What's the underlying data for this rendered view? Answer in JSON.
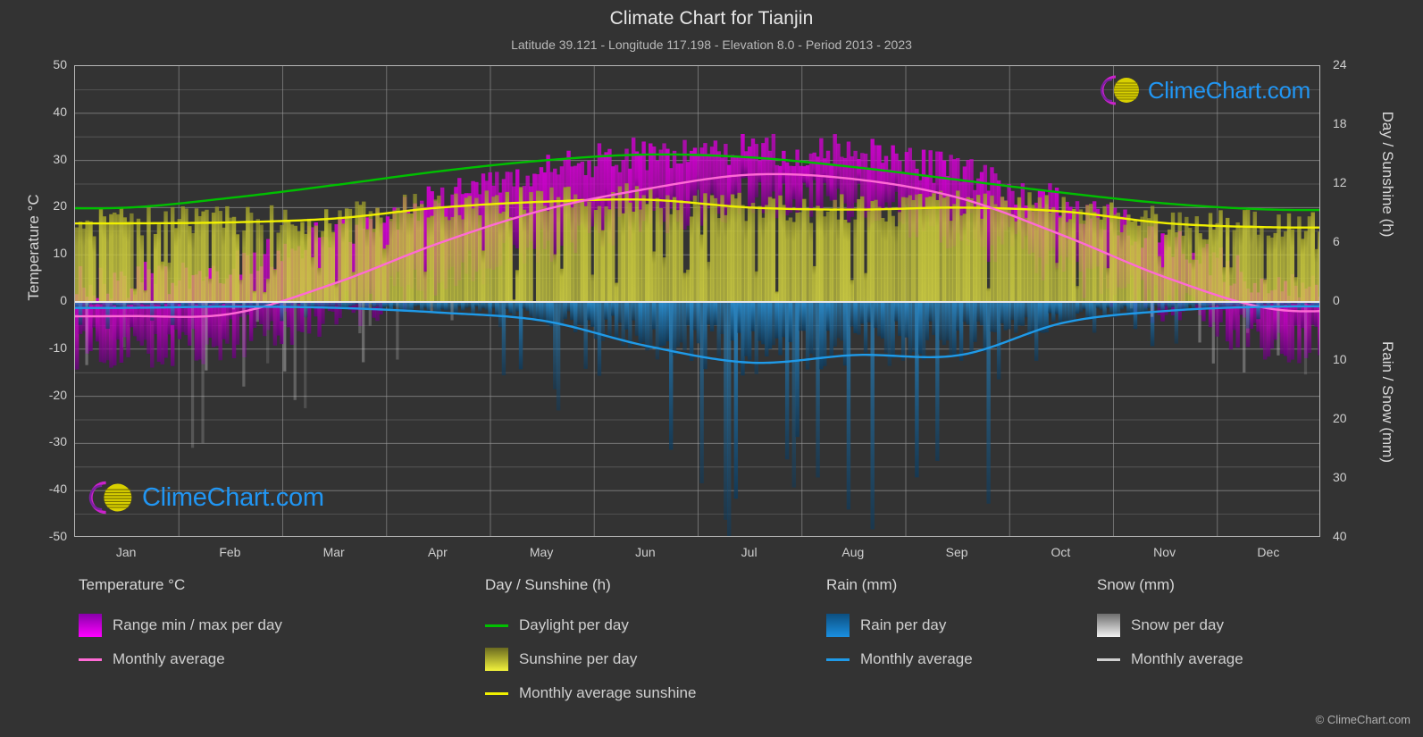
{
  "header": {
    "title": "Climate Chart for Tianjin",
    "subtitle": "Latitude 39.121 - Longitude 117.198 - Elevation 8.0 - Period 2013 - 2023"
  },
  "axes": {
    "y_left_title": "Temperature °C",
    "y_left_ticks": [
      "50",
      "40",
      "30",
      "20",
      "10",
      "0",
      "-10",
      "-20",
      "-30",
      "-40",
      "-50"
    ],
    "y_right_top_title": "Day / Sunshine (h)",
    "y_right_top_ticks": [
      "24",
      "18",
      "12",
      "6",
      "0"
    ],
    "y_right_bottom_title": "Rain / Snow (mm)",
    "y_right_bottom_ticks": [
      "0",
      "10",
      "20",
      "30",
      "40"
    ],
    "x_ticks": [
      "Jan",
      "Feb",
      "Mar",
      "Apr",
      "May",
      "Jun",
      "Jul",
      "Aug",
      "Sep",
      "Oct",
      "Nov",
      "Dec"
    ]
  },
  "legend": {
    "columns": [
      {
        "heading": "Temperature °C",
        "items": [
          {
            "label": "Range min / max per day",
            "marker": "swatch",
            "color": "#ff00ff",
            "color2": "#8800aa"
          },
          {
            "label": "Monthly average",
            "marker": "line",
            "color": "#ff6ad5"
          }
        ]
      },
      {
        "heading": "Day / Sunshine (h)",
        "items": [
          {
            "label": "Daylight per day",
            "marker": "line",
            "color": "#00c000"
          },
          {
            "label": "Sunshine per day",
            "marker": "swatch",
            "color": "#f2f23c",
            "color2": "#6a6a20"
          },
          {
            "label": "Monthly average sunshine",
            "marker": "line",
            "color": "#f0f000"
          }
        ]
      },
      {
        "heading": "Rain (mm)",
        "items": [
          {
            "label": "Rain per day",
            "marker": "swatch",
            "color": "#1a8fe0",
            "color2": "#0c4f80"
          },
          {
            "label": "Monthly average",
            "marker": "line",
            "color": "#1f9ae8"
          }
        ]
      },
      {
        "heading": "Snow (mm)",
        "items": [
          {
            "label": "Snow per day",
            "marker": "swatch",
            "color": "#f2f2f2",
            "color2": "#6e6e6e"
          },
          {
            "label": "Monthly average",
            "marker": "line",
            "color": "#d0d0d0"
          }
        ]
      }
    ]
  },
  "watermark": {
    "text": "ClimeChart.com"
  },
  "copyright": "© ClimeChart.com",
  "colors": {
    "background": "#333333",
    "grid": "#9a9a9a",
    "frame": "#b6b6b6",
    "daylight": "#00c000",
    "sunshine_avg": "#f0f000",
    "temp_avg": "#ff6ad5",
    "rain_avg": "#1f9ae8",
    "temp_range": "#d400d4",
    "sunshine_band": "#c8c83c",
    "rain_band": "#1a7ec0",
    "snow_band": "#c8c8c8",
    "logo_arc": "#cc22cc",
    "logo_sphere": "#e0e000",
    "logo_text": "#2196f3"
  },
  "chart_data": {
    "type": "line",
    "title": "Climate Chart for Tianjin",
    "subtitle": "Latitude 39.121 - Longitude 117.198 - Elevation 8.0 - Period 2013 - 2023",
    "xlabel": "",
    "ylabel": "Temperature °C",
    "ylim": [
      -50,
      50
    ],
    "y2lim_day": [
      0,
      24
    ],
    "y2lim_rain": [
      0,
      40
    ],
    "grid": true,
    "legend_position": "below",
    "categories": [
      "Jan",
      "Feb",
      "Mar",
      "Apr",
      "May",
      "Jun",
      "Jul",
      "Aug",
      "Sep",
      "Oct",
      "Nov",
      "Dec"
    ],
    "series": [
      {
        "name": "Monthly average temperature (°C)",
        "color": "#ff6ad5",
        "axis": "temperature",
        "values": [
          -3.0,
          -2.5,
          4.0,
          12.5,
          19.5,
          24.0,
          27.0,
          26.0,
          22.0,
          14.0,
          5.0,
          -1.5
        ]
      },
      {
        "name": "Daily max temperature (°C, band top)",
        "color": "#d400d4",
        "axis": "temperature",
        "values": [
          4.0,
          7.0,
          14.0,
          21.0,
          27.0,
          31.0,
          32.0,
          31.0,
          27.0,
          20.0,
          12.0,
          4.0
        ]
      },
      {
        "name": "Daily min temperature (°C, band bottom)",
        "color": "#8800aa",
        "axis": "temperature",
        "values": [
          -10.0,
          -8.0,
          -2.0,
          5.0,
          12.0,
          18.0,
          22.0,
          21.0,
          15.0,
          7.0,
          -1.0,
          -8.0
        ]
      },
      {
        "name": "Daylight per day (h)",
        "color": "#00c000",
        "axis": "day",
        "values": [
          9.6,
          10.6,
          11.9,
          13.3,
          14.4,
          15.0,
          14.7,
          13.7,
          12.4,
          11.1,
          10.0,
          9.4
        ]
      },
      {
        "name": "Monthly average sunshine (h)",
        "color": "#f0f000",
        "axis": "day",
        "values": [
          8.0,
          8.1,
          8.5,
          9.6,
          10.2,
          10.4,
          9.6,
          9.4,
          9.6,
          9.2,
          8.0,
          7.6
        ]
      },
      {
        "name": "Monthly average rain (mm)",
        "color": "#1f9ae8",
        "axis": "rain",
        "values": [
          1.0,
          0.8,
          1.0,
          1.8,
          3.2,
          7.5,
          10.3,
          9.0,
          9.0,
          3.5,
          1.5,
          0.8
        ]
      },
      {
        "name": "Monthly average snow (mm)",
        "color": "#d0d0d0",
        "axis": "rain",
        "values": [
          0.3,
          0.5,
          0.4,
          0.1,
          0.0,
          0.0,
          0.0,
          0.0,
          0.0,
          0.0,
          0.1,
          0.3
        ]
      }
    ]
  }
}
